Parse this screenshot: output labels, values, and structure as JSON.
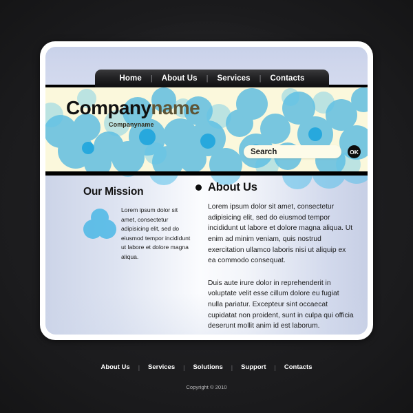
{
  "page": {
    "background_color": "#1b1b1d",
    "card_color": "#ffffff",
    "accent_blue": "#2aa8e0",
    "banner_color": "#fbf8dc"
  },
  "nav": {
    "items": [
      {
        "label": "Home"
      },
      {
        "label": "About Us"
      },
      {
        "label": "Services"
      },
      {
        "label": "Contacts"
      }
    ],
    "separator": "|"
  },
  "banner": {
    "logo_part_a": "Company",
    "logo_part_b": "name",
    "logo_subtitle": "Companyname",
    "search": {
      "value": "Search",
      "placeholder": "Search",
      "button_label": "OK",
      "button_icon": "ok-icon"
    }
  },
  "main": {
    "mission": {
      "title": "Our Mission",
      "graphic": "three-circles-icon",
      "text": "Lorem ipsum dolor sit amet, consectetur adipisicing elit, sed do eiusmod tempor incididunt ut labore et dolore magna aliqua."
    },
    "about": {
      "bullet": "bullet-icon",
      "title": "About Us",
      "paragraph_1": "Lorem ipsum dolor sit amet, consectetur adipisicing elit, sed do eiusmod tempor incididunt ut labore et dolore magna aliqua. Ut enim ad minim veniam, quis nostrud exercitation ullamco laboris nisi ut aliquip ex ea commodo consequat.",
      "paragraph_2": "Duis aute irure dolor in reprehenderit in voluptate velit esse cillum dolore eu fugiat nulla pariatur. Excepteur sint occaecat cupidatat non proident, sunt in culpa qui officia deserunt mollit anim id est laborum."
    }
  },
  "footer": {
    "items": [
      {
        "label": "About Us"
      },
      {
        "label": "Services"
      },
      {
        "label": "Solutions"
      },
      {
        "label": "Support"
      },
      {
        "label": "Contacts"
      }
    ],
    "separator": "|",
    "copyright": "Copyright © 2010"
  }
}
